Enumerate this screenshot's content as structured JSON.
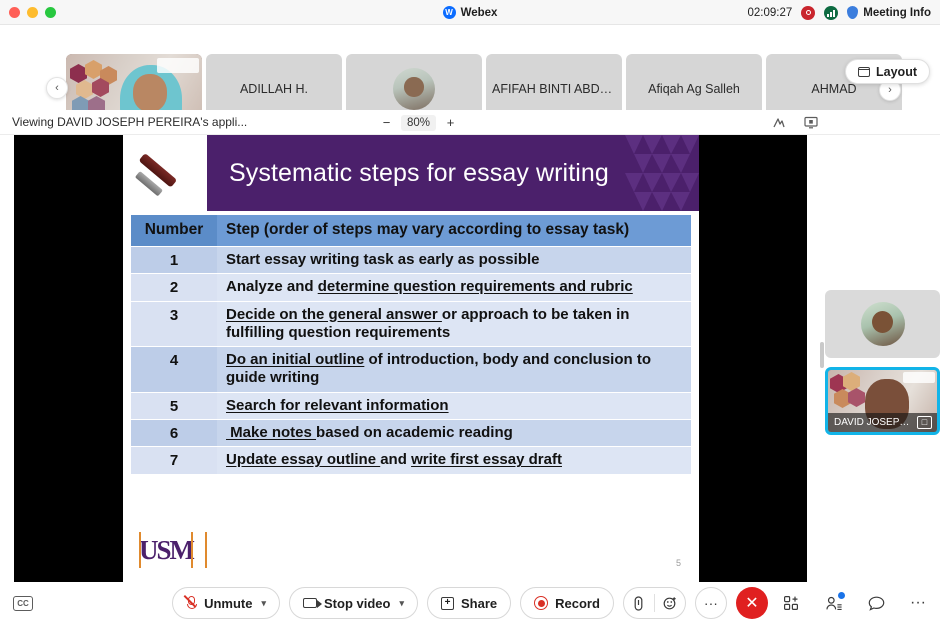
{
  "window": {
    "app_title": "Webex",
    "timer": "02:09:27",
    "meeting_info_label": "Meeting Info",
    "logo_glyph": "W",
    "recording_icon": "record-indicator-icon",
    "signal_icon": "signal-strength-icon",
    "traffic_lights": [
      "close",
      "minimize",
      "zoom"
    ]
  },
  "filmstrip": {
    "prev_label": "‹",
    "next_label": "›",
    "layout_label": "Layout",
    "tiles": [
      {
        "name": "",
        "type": "video"
      },
      {
        "name": "ADILLAH H.",
        "type": "name"
      },
      {
        "name": "",
        "type": "avatar"
      },
      {
        "name": "AFIFAH BINTI ABDU...",
        "type": "name"
      },
      {
        "name": "Afiqah Ag Salleh",
        "type": "name"
      },
      {
        "name": "AHMAD",
        "type": "name"
      }
    ]
  },
  "viewbar": {
    "viewing_text": "Viewing DAVID JOSEPH PEREIRA's appli...",
    "zoom_out": "−",
    "zoom_value": "80%",
    "zoom_in": "+",
    "annotate_icon": "annotate-icon",
    "fit_screen_icon": "fit-to-screen-icon"
  },
  "slide": {
    "title": "Systematic steps for essay writing",
    "page_number": "5",
    "logo_text": "USM",
    "table": {
      "headers": [
        "Number",
        "Step (order of steps may vary according to essay task)"
      ],
      "rows": [
        {
          "number": "1",
          "parts": [
            {
              "t": "Start essay writing task as early as possible",
              "u": false
            }
          ]
        },
        {
          "number": "2",
          "parts": [
            {
              "t": "Analyze and ",
              "u": false
            },
            {
              "t": "determine question requirements and rubric",
              "u": true
            }
          ]
        },
        {
          "number": "3",
          "parts": [
            {
              "t": "Decide on the general answer ",
              "u": true
            },
            {
              "t": "or approach to be taken in fulfilling question requirements",
              "u": false
            }
          ]
        },
        {
          "number": "4",
          "parts": [
            {
              "t": "Do an initial outline",
              "u": true
            },
            {
              "t": " of introduction, body and conclusion to guide writing",
              "u": false
            }
          ]
        },
        {
          "number": "5",
          "parts": [
            {
              "t": "Search for relevant information",
              "u": true
            }
          ]
        },
        {
          "number": "6",
          "parts": [
            {
              "t": "Make notes ",
              "u": true
            },
            {
              "t": "based on academic reading",
              "u": false
            }
          ]
        },
        {
          "number": "7",
          "parts": [
            {
              "t": "Update essay outline ",
              "u": true
            },
            {
              "t": "and ",
              "u": false
            },
            {
              "t": "write first essay draft",
              "u": true
            }
          ]
        }
      ]
    },
    "colors": {
      "banner": "#4b206b",
      "header_number": "#5b8cc8",
      "header_step": "#6d9bd5",
      "row_dark": "#c7d5ec",
      "row_light": "#dde5f4",
      "logo_purple": "#4b206b",
      "logo_orange": "#e08a2e"
    }
  },
  "rail": {
    "tiles": [
      {
        "name": "",
        "active": false
      },
      {
        "name": "DAVID JOSEPH P...",
        "active": true
      }
    ],
    "active_border_color": "#12b4e8",
    "pin_icon": "pin-video-icon"
  },
  "toolbar": {
    "cc_label": "CC",
    "unmute_label": "Unmute",
    "stop_video_label": "Stop video",
    "share_label": "Share",
    "record_label": "Record",
    "chevron": "⌄",
    "attach_icon": "attachment-icon",
    "reaction_icon": "reactions-icon",
    "more_label": "···",
    "leave_label": "✕",
    "apps_icon": "apps-grid-icon",
    "participants_icon": "participants-icon",
    "chat_icon": "chat-bubble-icon",
    "more_options_icon": "more-options-icon",
    "muted": true
  }
}
